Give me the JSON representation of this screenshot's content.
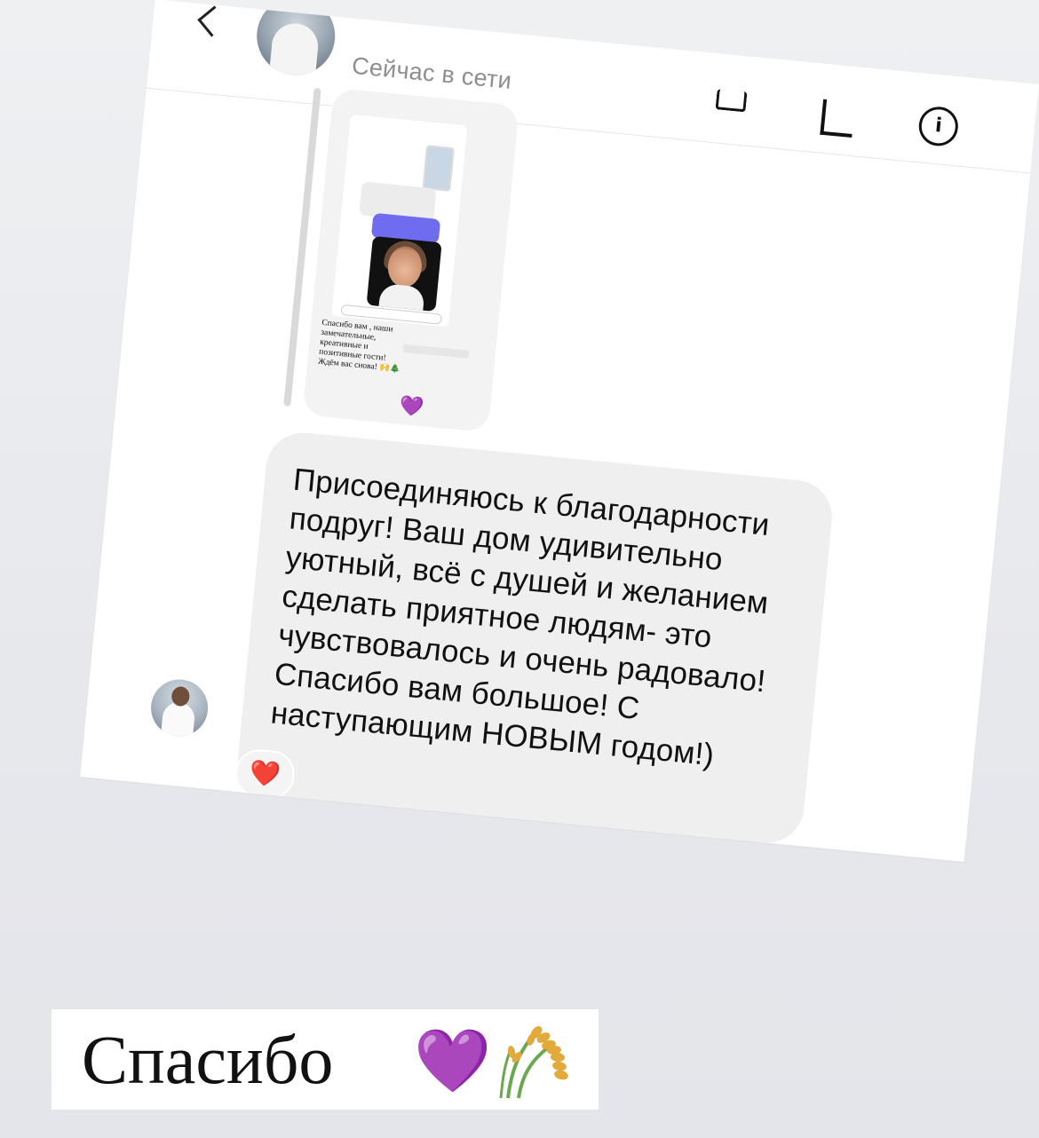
{
  "header": {
    "status": "Сейчас в сети",
    "info_glyph": "i"
  },
  "shared_post": {
    "caption": "Спасибо вам , наши\nзамечательные,\nкреативные и\nпозитивные гости!\nЖдём вас снова! 🙌🎄",
    "heart": "💜"
  },
  "message": {
    "text": "Присоединяюсь к благодарности подруг! Ваш дом удивительно уютный, всё с душей и желанием сделать приятное людям- это чувствовалось и очень радовало! Спасибо вам большое! С наступающим НОВЫМ годом!)",
    "reaction": "❤️"
  },
  "footer": {
    "thanks_text": "Спасибо",
    "heart": "💜"
  },
  "icons": [
    "back-icon",
    "video-call-icon",
    "phone-icon",
    "info-icon",
    "wheat-icon"
  ],
  "colors": {
    "bubble_gray": "#efefef",
    "purple_heart": "#9b4de4",
    "red_heart": "#e0242e",
    "status_gray": "#8e8e8e"
  }
}
